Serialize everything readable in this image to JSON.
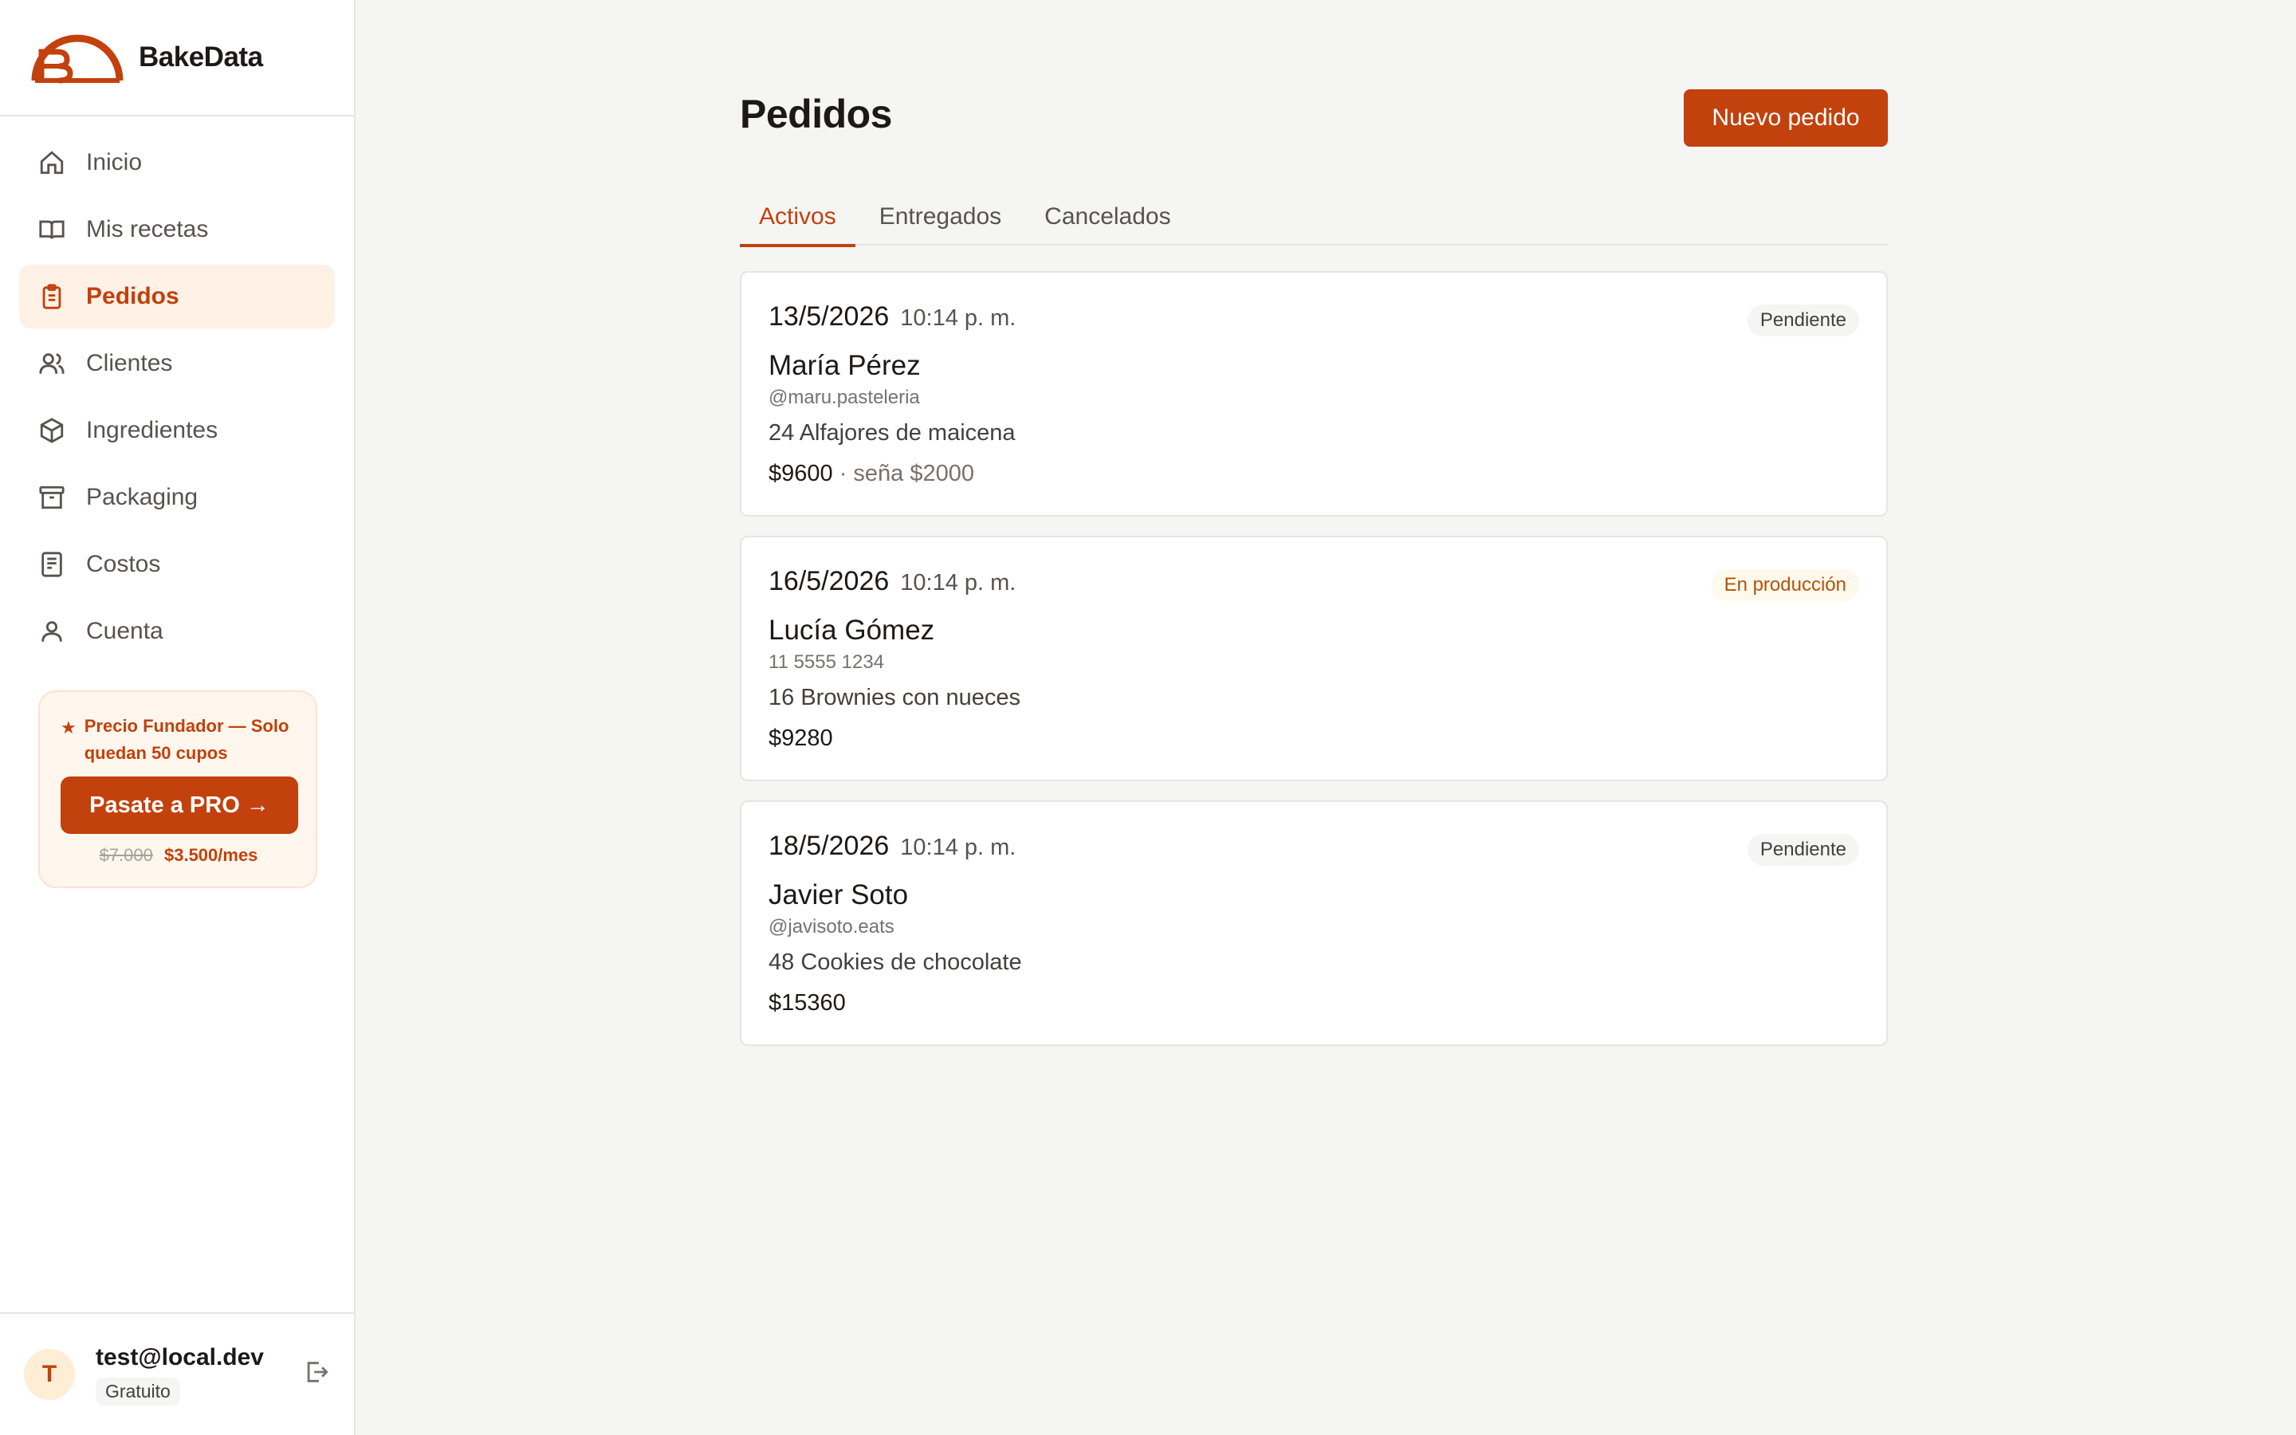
{
  "brand": {
    "name": "BakeData",
    "accent": "#c2410c"
  },
  "sidebar": {
    "items": [
      {
        "label": "Inicio",
        "icon": "home-icon",
        "active": false
      },
      {
        "label": "Mis recetas",
        "icon": "book-icon",
        "active": false
      },
      {
        "label": "Pedidos",
        "icon": "clipboard-icon",
        "active": true
      },
      {
        "label": "Clientes",
        "icon": "users-icon",
        "active": false
      },
      {
        "label": "Ingredientes",
        "icon": "box-icon",
        "active": false
      },
      {
        "label": "Packaging",
        "icon": "archive-icon",
        "active": false
      },
      {
        "label": "Costos",
        "icon": "receipt-icon",
        "active": false
      },
      {
        "label": "Cuenta",
        "icon": "user-icon",
        "active": false
      }
    ],
    "promo": {
      "text": "Precio Fundador — Solo quedan 50 cupos",
      "button": "Pasate a PRO →",
      "old_price": "$7.000",
      "new_price": "$3.500/mes"
    },
    "user": {
      "initial": "T",
      "email": "test@local.dev",
      "plan": "Gratuito"
    }
  },
  "main": {
    "title": "Pedidos",
    "new_button": "Nuevo pedido",
    "tabs": [
      {
        "label": "Activos",
        "active": true
      },
      {
        "label": "Entregados",
        "active": false
      },
      {
        "label": "Cancelados",
        "active": false
      }
    ],
    "orders": [
      {
        "date": "13/5/2026",
        "time": "10:14 p. m.",
        "status": "Pendiente",
        "customer": "María Pérez",
        "contact": "@maru.pasteleria",
        "product": "24 Alfajores de maicena",
        "price": "$9600",
        "deposit": " · seña $2000"
      },
      {
        "date": "16/5/2026",
        "time": "10:14 p. m.",
        "status": "En producción",
        "customer": "Lucía Gómez",
        "contact": "11 5555 1234",
        "product": "16 Brownies con nueces",
        "price": "$9280",
        "deposit": ""
      },
      {
        "date": "18/5/2026",
        "time": "10:14 p. m.",
        "status": "Pendiente",
        "customer": "Javier Soto",
        "contact": "@javisoto.eats",
        "product": "48 Cookies de chocolate",
        "price": "$15360",
        "deposit": ""
      }
    ]
  }
}
